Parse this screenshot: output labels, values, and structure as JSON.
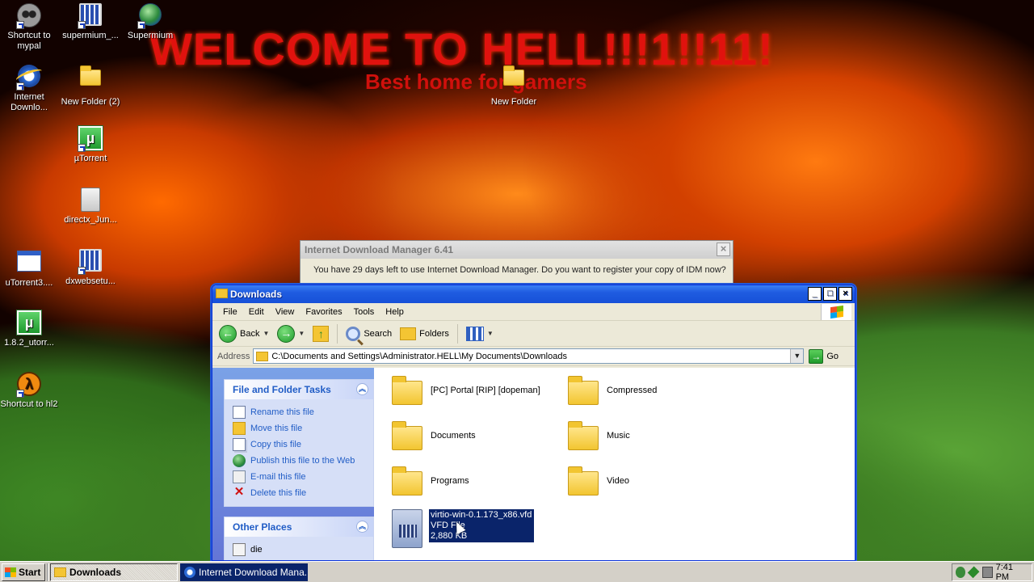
{
  "wallpaper": {
    "title": "WELCOME TO HELL!!!1!!11!",
    "subtitle": "Best home for gamers"
  },
  "desktop_icons": [
    {
      "label": "Shortcut to mypal",
      "icon": "raccoon-icon"
    },
    {
      "label": "supermium_...",
      "icon": "program-icon"
    },
    {
      "label": "Supermium",
      "icon": "globe-icon"
    },
    {
      "label": "Internet Downlo...",
      "icon": "ie-icon"
    },
    {
      "label": "New Folder (2)",
      "icon": "folder-icon"
    },
    {
      "label": "New Folder",
      "icon": "folder-icon"
    },
    {
      "label": "µTorrent",
      "icon": "utorrent-icon"
    },
    {
      "label": "directx_Jun...",
      "icon": "file-icon"
    },
    {
      "label": "uTorrent3....",
      "icon": "window-icon"
    },
    {
      "label": "dxwebsetu...",
      "icon": "program-icon"
    },
    {
      "label": "1.8.2_utorr...",
      "icon": "utorrent-icon"
    },
    {
      "label": "Shortcut to hl2",
      "icon": "halflife-icon"
    }
  ],
  "idm_dialog": {
    "title": "Internet Download Manager 6.41",
    "message": "You have 29 days left to use Internet Download Manager. Do you want to register your copy of IDM now?",
    "close": "×"
  },
  "explorer": {
    "title": "Downloads",
    "minimize": "_",
    "maximize": "□",
    "close": "×",
    "menu": [
      "File",
      "Edit",
      "View",
      "Favorites",
      "Tools",
      "Help"
    ],
    "toolbar": {
      "back": "Back",
      "search": "Search",
      "folders": "Folders"
    },
    "address": {
      "label": "Address",
      "value": "C:\\Documents and Settings\\Administrator.HELL\\My Documents\\Downloads",
      "go": "Go"
    },
    "file_tasks": {
      "title": "File and Folder Tasks",
      "items": [
        "Rename this file",
        "Move this file",
        "Copy this file",
        "Publish this file to the Web",
        "E-mail this file",
        "Delete this file"
      ]
    },
    "other_places": {
      "title": "Other Places",
      "items": [
        "die"
      ]
    },
    "files": [
      {
        "name": "[PC] Portal [RIP] [dopeman]",
        "type": "folder"
      },
      {
        "name": "Compressed",
        "type": "folder"
      },
      {
        "name": "Documents",
        "type": "folder"
      },
      {
        "name": "Music",
        "type": "folder"
      },
      {
        "name": "Programs",
        "type": "folder"
      },
      {
        "name": "Video",
        "type": "folder"
      },
      {
        "name": "virtio-win-0.1.173_x86.vfd",
        "type_label": "VFD File",
        "size": "2,880 KB",
        "type": "file",
        "selected": true
      }
    ]
  },
  "taskbar": {
    "start": "Start",
    "tasks": [
      "Downloads",
      "Internet Download Mana..."
    ],
    "clock": "7:41 PM"
  }
}
